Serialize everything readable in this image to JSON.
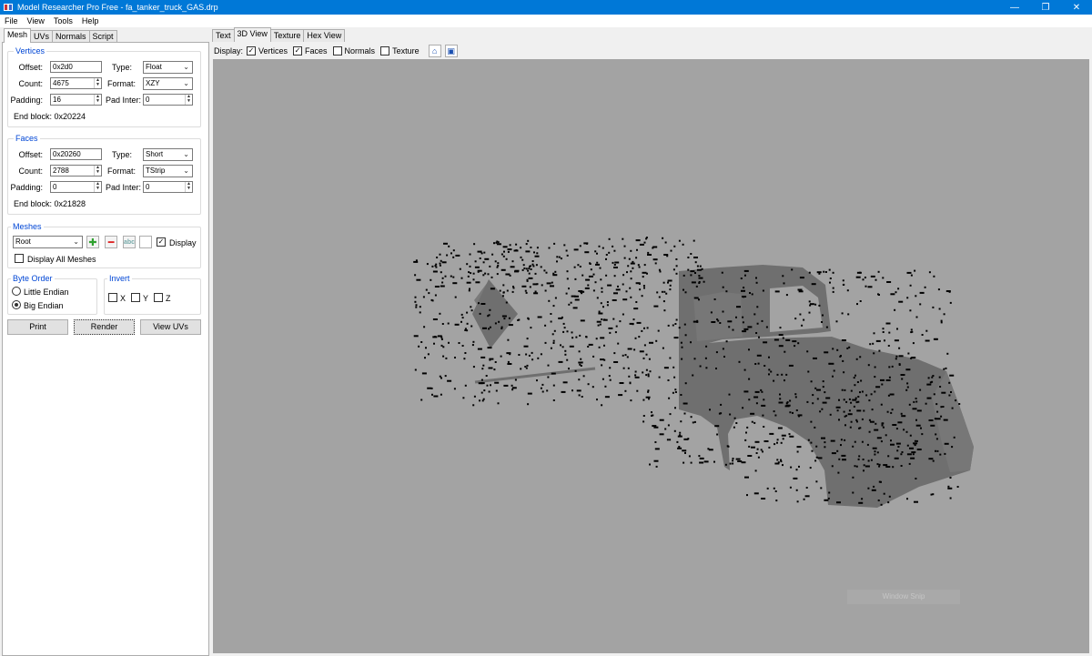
{
  "window": {
    "title": "Model Researcher Pro Free - fa_tanker_truck_GAS.drp",
    "controls": [
      "—",
      "❐",
      "✕"
    ]
  },
  "menu": [
    "File",
    "View",
    "Tools",
    "Help"
  ],
  "left_tabs": [
    "Mesh",
    "UVs",
    "Normals",
    "Script"
  ],
  "vertices": {
    "title": "Vertices",
    "offset_label": "Offset:",
    "offset": "0x2d0",
    "count_label": "Count:",
    "count": "4675",
    "padding_label": "Padding:",
    "padding": "16",
    "type_label": "Type:",
    "type": "Float",
    "format_label": "Format:",
    "format": "XZY",
    "pad_inter_label": "Pad Inter:",
    "pad_inter": "0",
    "end_block": "End block: 0x20224"
  },
  "faces": {
    "title": "Faces",
    "offset_label": "Offset:",
    "offset": "0x20260",
    "count_label": "Count:",
    "count": "2788",
    "padding_label": "Padding:",
    "padding": "0",
    "type_label": "Type:",
    "type": "Short",
    "format_label": "Format:",
    "format": "TStrip",
    "pad_inter_label": "Pad Inter:",
    "pad_inter": "0",
    "end_block": "End block: 0x21828"
  },
  "meshes": {
    "title": "Meshes",
    "selected": "Root",
    "display_label": "Display",
    "display_checked": true,
    "display_all_label": "Display All Meshes",
    "display_all_checked": false
  },
  "byte_order": {
    "title": "Byte Order",
    "options": [
      "Little Endian",
      "Big Endian"
    ],
    "selected": "Big Endian"
  },
  "invert": {
    "title": "Invert",
    "axes": [
      "X",
      "Y",
      "Z"
    ]
  },
  "buttons": {
    "print": "Print",
    "render": "Render",
    "view_uvs": "View UVs"
  },
  "right_tabs": [
    "Text",
    "3D View",
    "Texture",
    "Hex View"
  ],
  "right_active_tab": "3D View",
  "display": {
    "label": "Display:",
    "vertices": "Vertices",
    "vertices_checked": true,
    "faces": "Faces",
    "faces_checked": true,
    "normals": "Normals",
    "normals_checked": false,
    "texture": "Texture",
    "texture_checked": false
  },
  "viewport": {
    "background": "#a3a3a3",
    "mesh_color": "#6f6f6f",
    "vertex_color": "#000000",
    "overlay_text": "Window Snip"
  }
}
